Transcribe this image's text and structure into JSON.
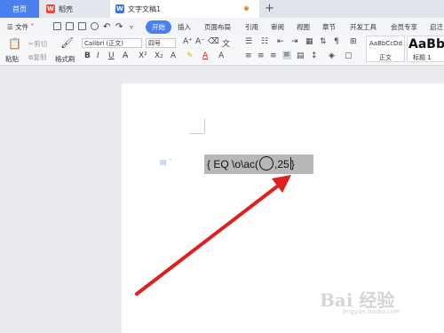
{
  "tabs": {
    "home": "首页",
    "shell": "稻壳",
    "doc": "文字文稿1",
    "add": "+"
  },
  "menu": {
    "file": "文件",
    "items": [
      "开始",
      "插入",
      "页面布局",
      "引用",
      "审阅",
      "视图",
      "章节",
      "开发工具",
      "会员专享",
      "启迁"
    ]
  },
  "toolbar": {
    "paste": "粘贴",
    "cut": "剪切",
    "copy": "复制",
    "format_painter": "格式刷",
    "font_name": "Calibri (正文)",
    "font_size": "四号",
    "style_preview_1": "AaBbCcDd",
    "style_name_1": "正文",
    "style_preview_2": "AaBbA",
    "style_name_2": "标题 1"
  },
  "document": {
    "field_code_prefix": "{ EQ \\o\\ac(",
    "field_code_suffix": ",25",
    "field_code_close": "}"
  },
  "watermark": {
    "brand": "Bai 经验",
    "url": "jingyan.baidu.com"
  },
  "colors": {
    "accent": "#4a7ff0",
    "arrow": "#e02020",
    "selection": "#b8b8b8"
  }
}
